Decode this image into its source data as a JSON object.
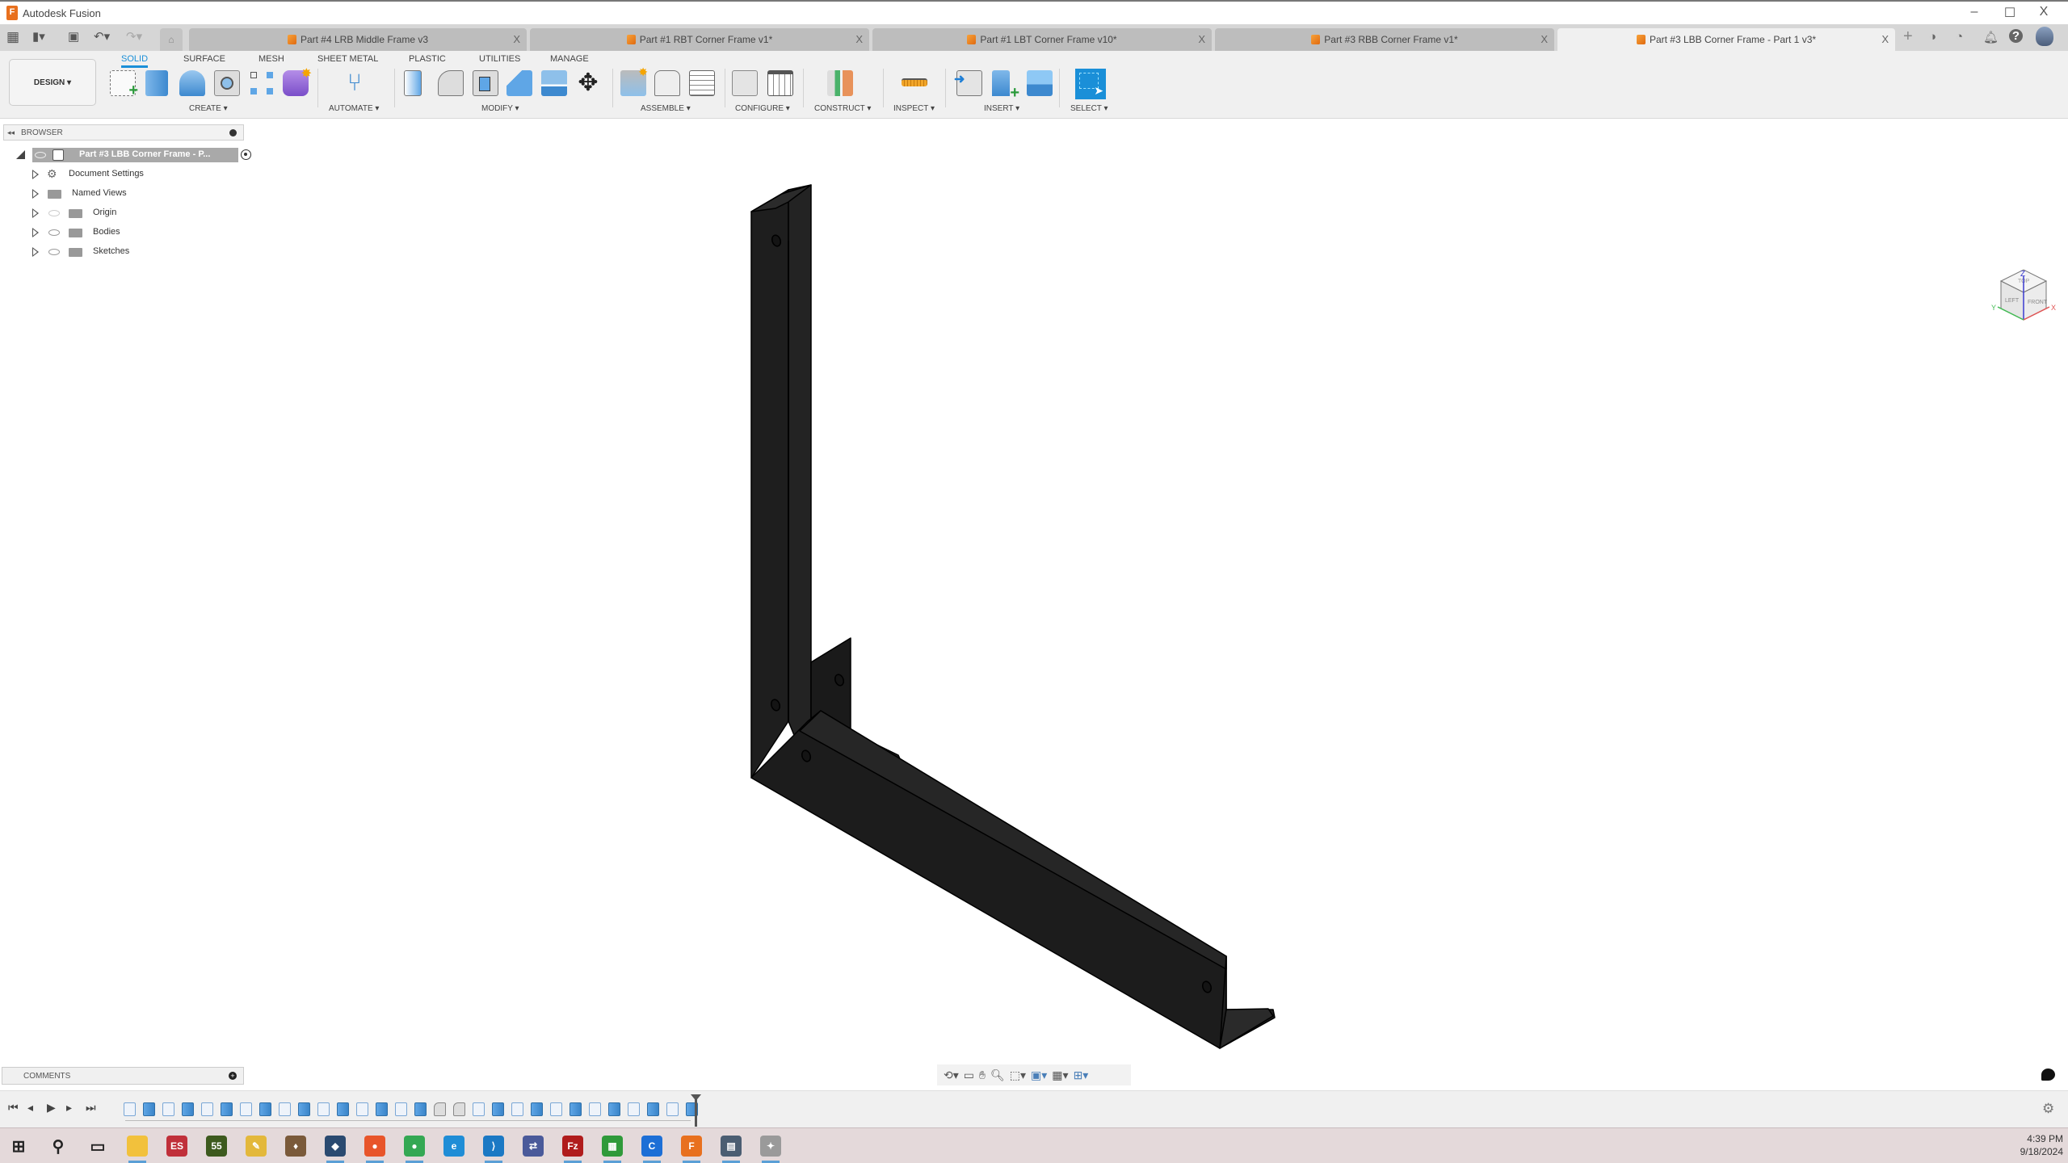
{
  "window": {
    "app_title": "Autodesk Fusion",
    "controls": {
      "minimize": "–",
      "maximize": "☐",
      "close": "X"
    }
  },
  "quick_access": {
    "icons": [
      "apps-grid-icon",
      "file-icon",
      "save-icon",
      "undo-icon",
      "redo-icon",
      "home-icon"
    ]
  },
  "doc_tabs": [
    {
      "label": "Part #4 LRB Middle Frame v3",
      "active": false
    },
    {
      "label": "Part #1 RBT Corner Frame v1*",
      "active": false
    },
    {
      "label": "Part #1 LBT Corner Frame v10*",
      "active": false
    },
    {
      "label": "Part #3 RBB Corner Frame v1*",
      "active": false
    },
    {
      "label": "Part #3 LBB Corner Frame - Part 1 v3*",
      "active": true
    }
  ],
  "tab_close_glyph": "X",
  "header_icons": [
    "new-tab-icon",
    "extensions-icon",
    "job-status-icon",
    "notifications-icon",
    "help-icon",
    "user-avatar"
  ],
  "workspace": {
    "label": "DESIGN ▾"
  },
  "ribbon_tabs": [
    {
      "label": "SOLID",
      "active": true
    },
    {
      "label": "SURFACE",
      "active": false
    },
    {
      "label": "MESH",
      "active": false
    },
    {
      "label": "SHEET METAL",
      "active": false
    },
    {
      "label": "PLASTIC",
      "active": false
    },
    {
      "label": "UTILITIES",
      "active": false
    },
    {
      "label": "MANAGE",
      "active": false
    }
  ],
  "ribbon_groups": [
    {
      "label": "CREATE ▾",
      "tools": [
        "create-sketch",
        "extrude",
        "revolve",
        "hole",
        "pattern",
        "form"
      ]
    },
    {
      "label": "AUTOMATE ▾",
      "tools": [
        "automate"
      ]
    },
    {
      "label": "MODIFY ▾",
      "tools": [
        "press-pull",
        "fillet",
        "shell",
        "combine",
        "offset-face",
        "move"
      ]
    },
    {
      "label": "ASSEMBLE ▾",
      "tools": [
        "new-component",
        "joint",
        "bill-of-materials"
      ]
    },
    {
      "label": "CONFIGURE ▾",
      "tools": [
        "configure",
        "configuration-table"
      ]
    },
    {
      "label": "CONSTRUCT ▾",
      "tools": [
        "offset-plane"
      ]
    },
    {
      "label": "INSPECT ▾",
      "tools": [
        "measure"
      ]
    },
    {
      "label": "INSERT ▾",
      "tools": [
        "insert-derive",
        "insert-mcmaster",
        "insert-canvas"
      ]
    },
    {
      "label": "SELECT ▾",
      "tools": [
        "select"
      ]
    }
  ],
  "browser": {
    "title": "BROWSER",
    "root": "Part #3 LBB Corner Frame - P...",
    "items": [
      {
        "label": "Document Settings",
        "icon": "gear-icon",
        "visible": null
      },
      {
        "label": "Named Views",
        "icon": "folder-icon",
        "visible": null
      },
      {
        "label": "Origin",
        "icon": "folder-icon",
        "visible": false
      },
      {
        "label": "Bodies",
        "icon": "folder-icon",
        "visible": true
      },
      {
        "label": "Sketches",
        "icon": "folder-icon",
        "visible": true
      }
    ]
  },
  "viewcube": {
    "faces": [
      "TOP",
      "LEFT",
      "FRONT"
    ],
    "axes": [
      "X",
      "Y",
      "Z"
    ]
  },
  "comments": {
    "title": "COMMENTS"
  },
  "model": {
    "body_color": "#1c1c1c",
    "edge_color": "#000000"
  },
  "nav_bar": {
    "icons": [
      "orbit-icon",
      "look-at-icon",
      "pan-icon",
      "zoom-icon",
      "fit-icon",
      "display-settings-icon",
      "grid-icon",
      "viewports-icon"
    ]
  },
  "timeline": {
    "controls": [
      "first",
      "previous",
      "play",
      "next",
      "last"
    ],
    "features": [
      "sketch",
      "extrude",
      "sketch",
      "extrude",
      "sketch",
      "extrude",
      "sketch",
      "extrude",
      "sketch",
      "extrude",
      "sketch",
      "extrude",
      "sketch",
      "extrude",
      "sketch",
      "extrude",
      "fillet",
      "fillet",
      "sketch",
      "extrude",
      "sketch",
      "extrude",
      "sketch",
      "extrude",
      "sketch",
      "extrude",
      "sketch",
      "extrude",
      "sketch",
      "extrude"
    ]
  },
  "taskbar": {
    "apps": [
      {
        "name": "start",
        "label": "⊞",
        "color": "#222"
      },
      {
        "name": "search",
        "label": "⚲",
        "color": "#222"
      },
      {
        "name": "task-view",
        "label": "▭",
        "color": "#222"
      },
      {
        "name": "file-explorer",
        "label": "",
        "color": "#f2c13c"
      },
      {
        "name": "es-app",
        "label": "ES",
        "color": "#c0303a"
      },
      {
        "name": "app-55",
        "label": "55",
        "color": "#3d5a1e"
      },
      {
        "name": "pen-app",
        "label": "✎",
        "color": "#e3b83b"
      },
      {
        "name": "game-app",
        "label": "♦",
        "color": "#7a5a3a"
      },
      {
        "name": "virtualbox",
        "label": "◆",
        "color": "#2a4a70"
      },
      {
        "name": "firefox",
        "label": "●",
        "color": "#e8552a"
      },
      {
        "name": "chrome",
        "label": "●",
        "color": "#34a853"
      },
      {
        "name": "edge",
        "label": "e",
        "color": "#1f8dd6"
      },
      {
        "name": "vscode",
        "label": "⟩",
        "color": "#1b79c4"
      },
      {
        "name": "network-app",
        "label": "⇄",
        "color": "#4a5a9a"
      },
      {
        "name": "filezilla",
        "label": "Fz",
        "color": "#b01c1c"
      },
      {
        "name": "spreadsheet-app",
        "label": "▦",
        "color": "#2f9a3a"
      },
      {
        "name": "c-app",
        "label": "C",
        "color": "#1d6fd6"
      },
      {
        "name": "fusion",
        "label": "F",
        "color": "#e8701e"
      },
      {
        "name": "calculator",
        "label": "▤",
        "color": "#4b5e72"
      },
      {
        "name": "gimp",
        "label": "✦",
        "color": "#9a9a9a"
      }
    ],
    "clock": {
      "time": "4:39 PM",
      "date": "9/18/2024"
    }
  }
}
